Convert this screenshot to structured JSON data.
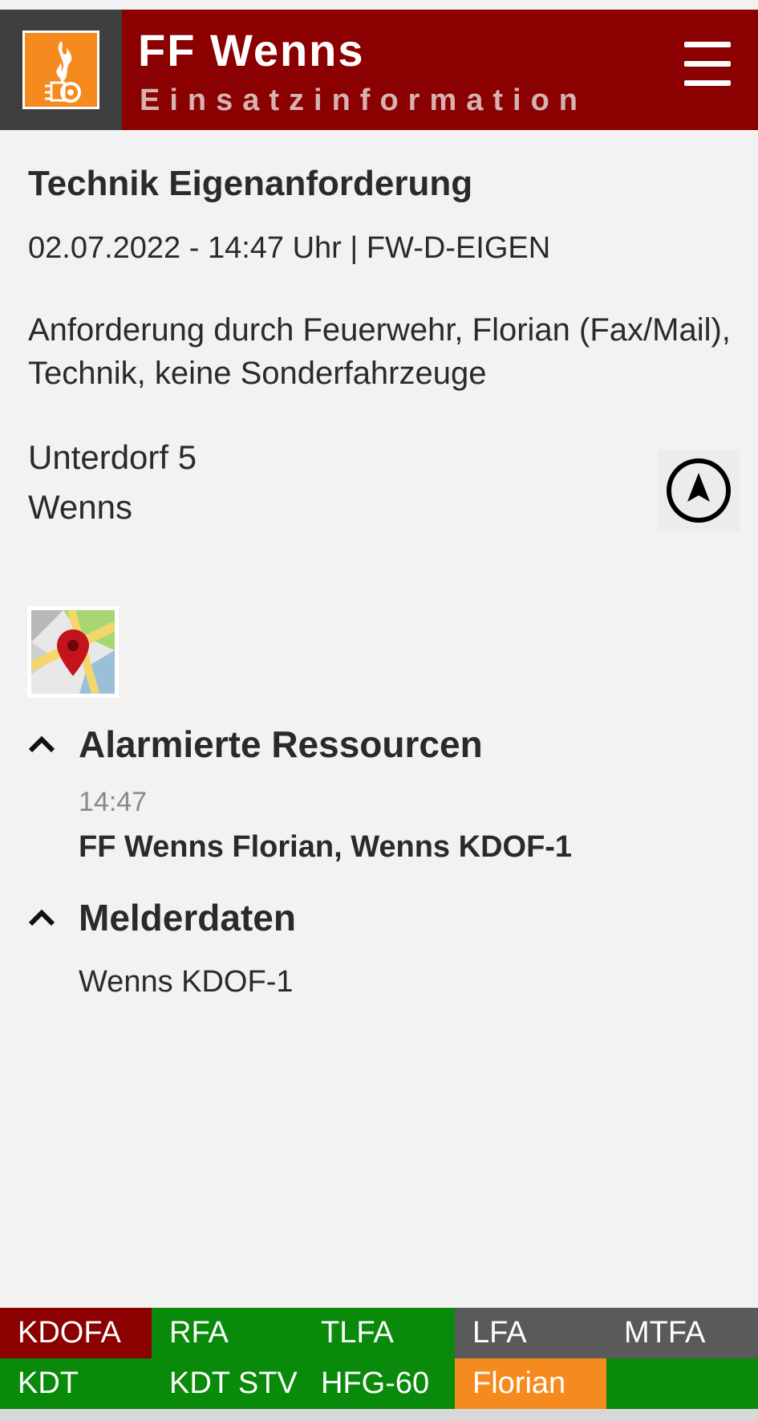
{
  "header": {
    "title": "FF Wenns",
    "subtitle": "Einsatzinformation",
    "logo_icon": "fire-brigade-logo-icon",
    "menu_icon": "hamburger-menu-icon"
  },
  "incident": {
    "title": "Technik Eigenanforderung",
    "meta": "02.07.2022 - 14:47 Uhr | FW-D-EIGEN",
    "description": "Anforderung durch Feuerwehr, Florian (Fax/Mail), Technik, keine Sonderfahrzeuge",
    "address_line1": "Unterdorf 5",
    "address_line2": "Wenns",
    "navigate_icon": "navigation-arrow-icon",
    "map_icon": "map-pin-icon"
  },
  "sections": {
    "resources": {
      "label": "Alarmierte Ressourcen",
      "time": "14:47",
      "text": "FF Wenns Florian, Wenns KDOF-1"
    },
    "melder": {
      "label": "Melderdaten",
      "text": "Wenns KDOF-1"
    }
  },
  "vehicles": [
    {
      "label": "KDOFA",
      "color": "#8b0000"
    },
    {
      "label": "RFA",
      "color": "#0a8a0a"
    },
    {
      "label": "TLFA",
      "color": "#0a8a0a"
    },
    {
      "label": "LFA",
      "color": "#5a5a5a"
    },
    {
      "label": "MTFA",
      "color": "#5a5a5a"
    },
    {
      "label": "KDT",
      "color": "#0a8a0a"
    },
    {
      "label": "KDT STV",
      "color": "#0a8a0a"
    },
    {
      "label": "HFG-60",
      "color": "#0a8a0a"
    },
    {
      "label": "Florian",
      "color": "#f58a1f"
    },
    {
      "label": "",
      "color": "#0a8a0a"
    }
  ],
  "colors": {
    "header_red": "#8b0000",
    "logo_orange": "#f58a1f",
    "status_green": "#0a8a0a",
    "status_gray": "#5a5a5a"
  }
}
